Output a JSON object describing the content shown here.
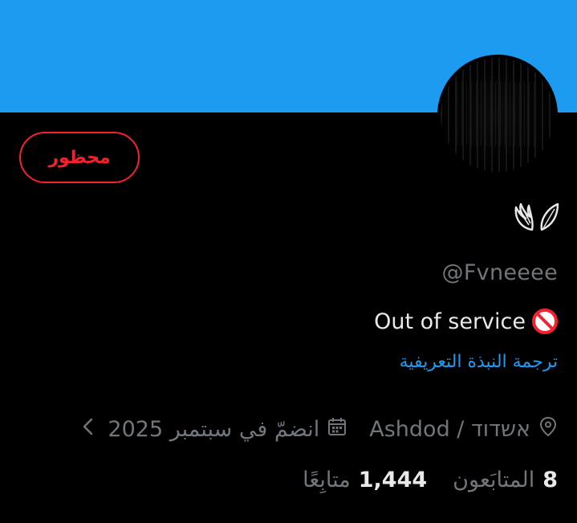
{
  "colors": {
    "banner": "#1d9bf0",
    "background": "#000000",
    "blocked": "#f4212e",
    "link": "#1d9bf0",
    "secondary_text": "#71767b",
    "primary_text": "#e7e9ea"
  },
  "profile": {
    "blocked_label": "محظور",
    "display_name_icon": "wings-emoji-icon",
    "handle": "@Fvneeee",
    "bio_text": "Out of service",
    "bio_icon": "no-entry-icon",
    "translate_label": "ترجمة النبذة التعريفية",
    "location": "Ashdod / אשדוד",
    "location_icon": "location-pin-icon",
    "joined": "انضمّ في سبتمبر 2025",
    "joined_icon": "calendar-icon",
    "more_icon": "chevron-left-icon",
    "followers_count": "8",
    "followers_label": "المتابَعون",
    "following_count": "1,444",
    "following_label": "متابِعًا"
  }
}
